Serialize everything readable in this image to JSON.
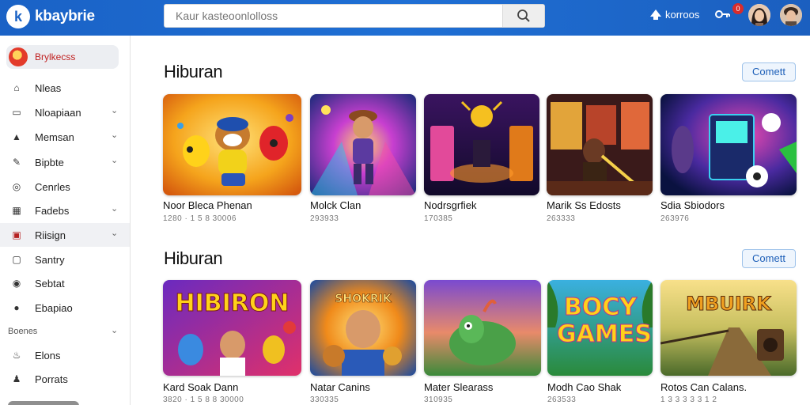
{
  "header": {
    "logo_letter": "k",
    "brand": "kbaybrie",
    "search_placeholder": "Kaur kasteoonlolloss",
    "upload_label": "korroos",
    "notif_count": "0"
  },
  "sidebar": {
    "top_item": "Brylkecss",
    "items": [
      {
        "label": "Nleas",
        "icon": "home-icon",
        "chevron": false
      },
      {
        "label": "Nloapiaan",
        "icon": "folder-icon",
        "chevron": true
      },
      {
        "label": "Memsan",
        "icon": "play-icon",
        "chevron": true
      },
      {
        "label": "Bipbte",
        "icon": "pen-icon",
        "chevron": true
      },
      {
        "label": "Cenrles",
        "icon": "gamepad-icon",
        "chevron": false
      },
      {
        "label": "Fadebs",
        "icon": "chart-icon",
        "chevron": true
      },
      {
        "label": "Riisign",
        "icon": "briefcase-icon",
        "chevron": true,
        "active": true
      },
      {
        "label": "Santry",
        "icon": "controller-icon",
        "chevron": false
      },
      {
        "label": "Sebtat",
        "icon": "target-icon",
        "chevron": false
      },
      {
        "label": "Ebapiao",
        "icon": "compass-icon",
        "chevron": false
      }
    ],
    "section_label": "Boenes",
    "section_items": [
      {
        "label": "Elons",
        "icon": "flame-icon"
      },
      {
        "label": "Porrats",
        "icon": "person-icon"
      }
    ]
  },
  "sections": [
    {
      "title": "Hiburan",
      "more_label": "Comett",
      "cards": [
        {
          "title": "Noor Bleca Phenan",
          "meta": "1280 · 1 5 8 30006"
        },
        {
          "title": "Molck Clan",
          "meta": "293933"
        },
        {
          "title": "Nodrsgrfiek",
          "meta": "170385"
        },
        {
          "title": "Marik Ss Edosts",
          "meta": "263333"
        },
        {
          "title": "Sdia Sbiodors",
          "meta": "263976"
        }
      ]
    },
    {
      "title": "Hiburan",
      "more_label": "Comett",
      "cards": [
        {
          "title": "Kard Soak Dann",
          "meta": "3820 · 1 5 8 8 30000",
          "art": "HIBIRON"
        },
        {
          "title": "Natar Canins",
          "meta": "330335",
          "art": "SHOKRIK"
        },
        {
          "title": "Mater Slearass",
          "meta": "310935"
        },
        {
          "title": "Modh Cao Shak",
          "meta": "263533",
          "art": "BOCY GAMES"
        },
        {
          "title": "Rotos Can Calans.",
          "meta": "1 3 3 3 3 3 1 2",
          "art": "MBUIRK"
        }
      ]
    }
  ],
  "colors": {
    "topbar": "#1d66cc",
    "accent_red": "#c02020",
    "more_border": "#9fc3ea"
  }
}
